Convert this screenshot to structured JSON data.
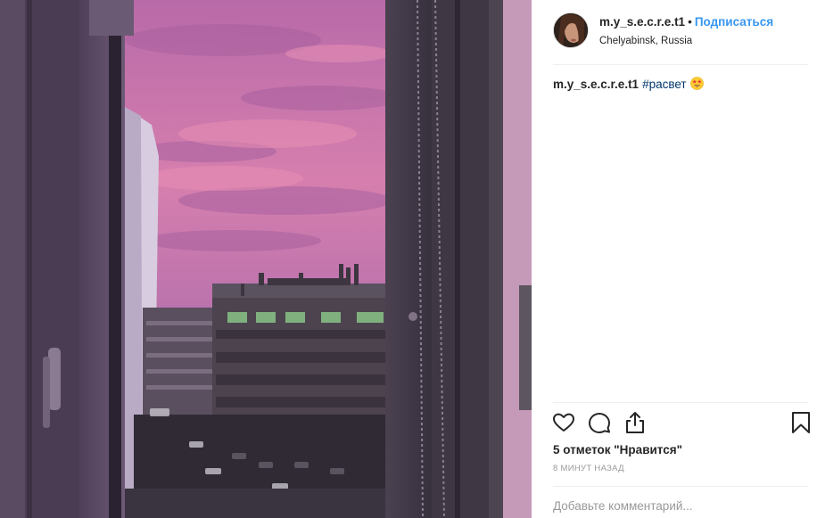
{
  "post": {
    "username": "m.y_s.e.c.r.e.t1",
    "separator": "•",
    "follow_label": "Подписаться",
    "location": "Chelyabinsk, Russia"
  },
  "caption": {
    "username": "m.y_s.e.c.r.e.t1",
    "hashtag": "#расвет",
    "emoji": "star-struck-emoji"
  },
  "actions": {
    "like_icon": "heart-icon",
    "comment_icon": "comment-icon",
    "share_icon": "share-icon",
    "save_icon": "bookmark-icon"
  },
  "likes_text": "5 отметок \"Нравится\"",
  "time_text": "8 МИНУТ НАЗАД",
  "comment": {
    "placeholder": "Добавьте комментарий..."
  },
  "colors": {
    "link_blue": "#3897f0",
    "hashtag": "#003569",
    "muted": "#999999",
    "text": "#262626"
  }
}
